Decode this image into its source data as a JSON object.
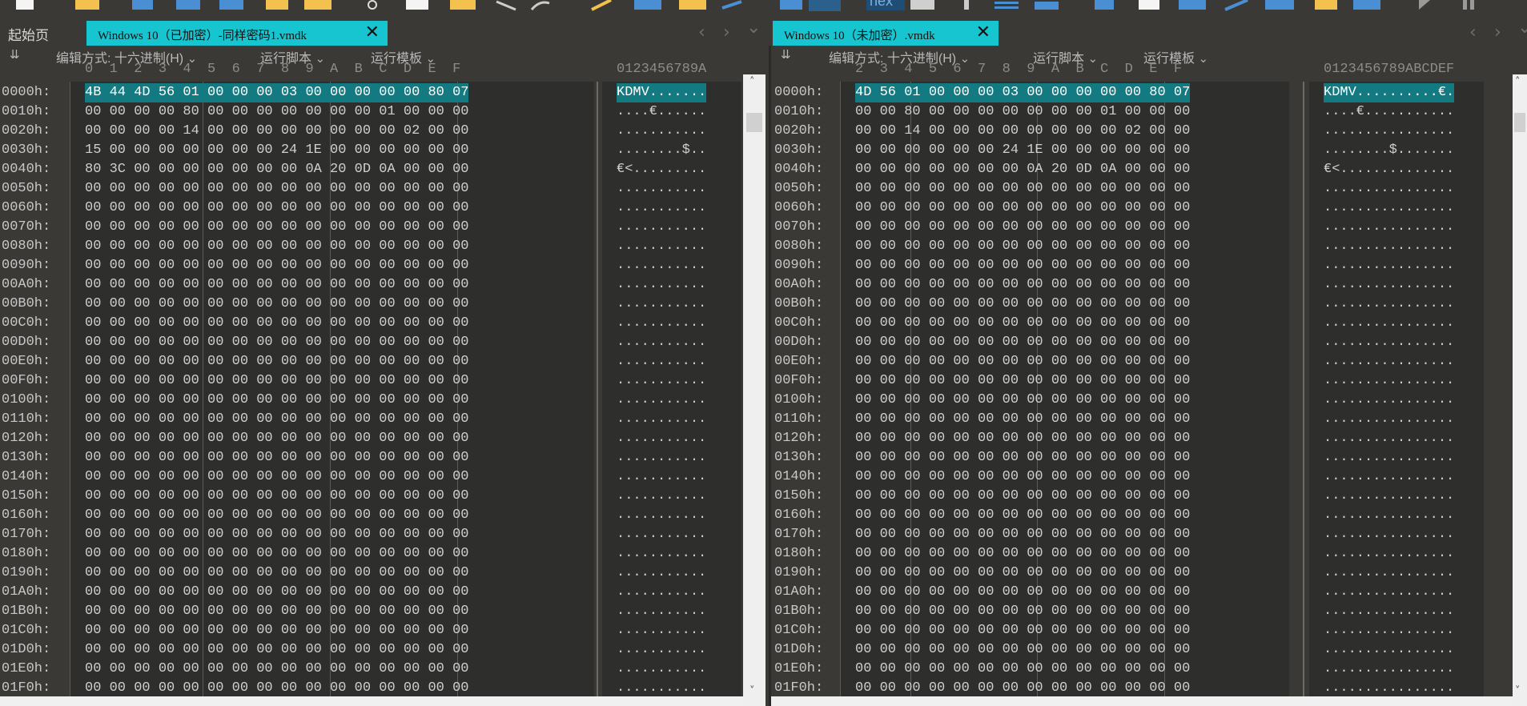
{
  "tabs": {
    "start": "起始页",
    "left_file": "Windows 10（已加密）-同样密码1.vmdk",
    "right_file": "Windows 10（未加密）.vmdk",
    "close_glyph": "✕",
    "nav_prev": "‹",
    "nav_next": "›",
    "nav_dropdown": "⌄"
  },
  "toolbar": {
    "hex_label": "hex",
    "icons": [
      "new-file-icon",
      "open-folder-icon",
      "save-icon",
      "save-as-icon",
      "save-all-icon",
      "open-icon",
      "open-multiple-icon",
      "scissors-icon",
      "copy-icon",
      "paste-icon",
      "undo-icon",
      "redo-icon",
      "find-icon",
      "font-icon",
      "find-replace-icon",
      "goto-icon",
      "text-mode-icon",
      "hex-mode-icon",
      "print-icon",
      "info-icon",
      "columns-icon",
      "binary-icon",
      "calculator-icon",
      "help-icon",
      "back-icon",
      "forward-icon",
      "chart-icon",
      "bookmark-icon",
      "base-convert-icon",
      "run-icon",
      "pause-icon"
    ]
  },
  "controls": {
    "edit_as": "编辑方式: 十六进制(H)",
    "run_script": "运行脚本",
    "run_template": "运行模板",
    "collapse_icon": "double-chevron-down-icon"
  },
  "left_pane": {
    "col_header": "0  1  2  3  4  5  6  7  8  9  A  B  C  D  E  F",
    "ascii_header": "0123456789A"
  },
  "right_pane": {
    "col_header": "2  3  4  5  6  7  8  9  A  B  C  D  E  F",
    "ascii_header": "0123456789ABCDEF"
  },
  "offsets": [
    "0000h:",
    "0010h:",
    "0020h:",
    "0030h:",
    "0040h:",
    "0050h:",
    "0060h:",
    "0070h:",
    "0080h:",
    "0090h:",
    "00A0h:",
    "00B0h:",
    "00C0h:",
    "00D0h:",
    "00E0h:",
    "00F0h:",
    "0100h:",
    "0110h:",
    "0120h:",
    "0130h:",
    "0140h:",
    "0150h:",
    "0160h:",
    "0170h:",
    "0180h:",
    "0190h:",
    "01A0h:",
    "01B0h:",
    "01C0h:",
    "01D0h:",
    "01E0h:",
    "01F0h:"
  ],
  "left_rows": [
    "4B 44 4D 56 01 00 00 00 03 00 00 00 00 00 80 07",
    "00 00 00 00 80 00 00 00 00 00 00 00 01 00 00 00",
    "00 00 00 00 14 00 00 00 00 00 00 00 00 02 00 00",
    "15 00 00 00 00 00 00 00 24 1E 00 00 00 00 00 00",
    "80 3C 00 00 00 00 00 00 00 0A 20 0D 0A 00 00 00"
  ],
  "left_ascii": [
    "KDMV.......",
    "....€......",
    "...........",
    "........$..",
    "€<.........",
    "..........."
  ],
  "right_rows": [
    "4D 56 01 00 00 00 03 00 00 00 00 00 80 07",
    "00 00 80 00 00 00 00 00 00 00 01 00 00 00",
    "00 00 14 00 00 00 00 00 00 00 00 02 00 00",
    "00 00 00 00 00 00 24 1E 00 00 00 00 00 00",
    "00 00 00 00 00 00 00 0A 20 0D 0A 00 00 00"
  ],
  "right_ascii": [
    "KDMV..........€.",
    "....€...........",
    "................",
    "........$.......",
    "€<..............",
    "................"
  ],
  "zero_row_left": "00 00 00 00 00 00 00 00 00 00 00 00 00 00 00 00",
  "zero_row_right": "00 00 00 00 00 00 00 00 00 00 00 00 00 00",
  "scroll_up": "˄",
  "scroll_down": "˅",
  "colors": {
    "accent": "#16c5d0",
    "highlight": "#127a80",
    "background": "#3a3935"
  }
}
